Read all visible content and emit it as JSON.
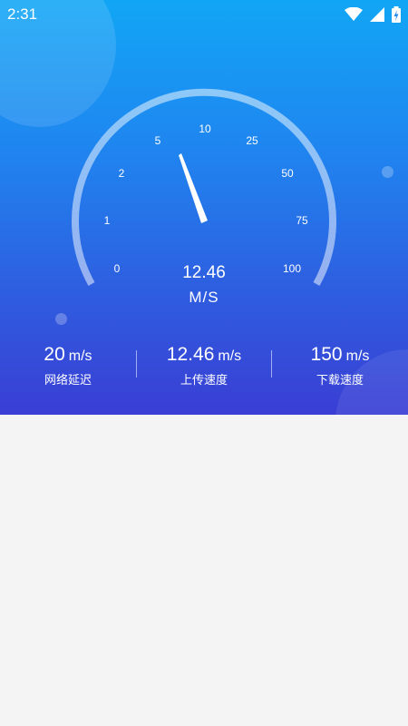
{
  "status_bar": {
    "time": "2:31"
  },
  "gauge": {
    "ticks": [
      "0",
      "1",
      "2",
      "5",
      "10",
      "25",
      "50",
      "75",
      "100"
    ],
    "speed_value": "12.46",
    "speed_unit": "M/S"
  },
  "stats": [
    {
      "value": "20",
      "unit": "m/s",
      "label": "网络延迟"
    },
    {
      "value": "12.46",
      "unit": "m/s",
      "label": "上传速度"
    },
    {
      "value": "150",
      "unit": "m/s",
      "label": "下载速度"
    }
  ],
  "colors": {
    "accent_top": "#11a6f5",
    "accent_bottom": "#3a3ed4",
    "background": "#f4f4f4"
  }
}
